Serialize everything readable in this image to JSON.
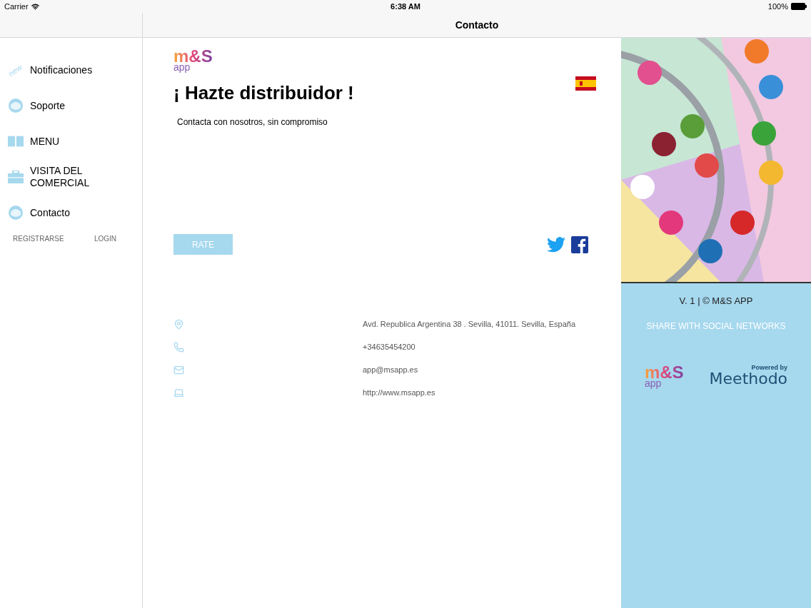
{
  "status_bar": {
    "carrier": "Carrier",
    "time": "6:38 AM",
    "battery": "100%"
  },
  "nav_bar": {
    "title": "Contacto"
  },
  "sidebar": {
    "items": [
      {
        "kind": "new",
        "label": "Notificaciones",
        "badge": "new"
      },
      {
        "kind": "face",
        "label": "Soporte"
      },
      {
        "kind": "book",
        "label": "MENU"
      },
      {
        "kind": "case",
        "label": "VISITA DEL COMERCIAL"
      },
      {
        "kind": "face",
        "label": "Contacto"
      }
    ],
    "links": [
      "REGISTRARSE",
      "LOGIN"
    ]
  },
  "main": {
    "logo": {
      "mark": "m&S",
      "sub": "app"
    },
    "title": "¡ Hazte distribuidor !",
    "subtitle": "Contacta con nosotros, sin compromiso",
    "rate_button": "RATE",
    "contacts": [
      {
        "kind": "pin",
        "value": "Avd. Republica Argentina 38 . Sevilla, 41011. Sevilla, España"
      },
      {
        "kind": "phone",
        "value": "+34635454200"
      },
      {
        "kind": "mail",
        "value": "app@msapp.es"
      },
      {
        "kind": "web",
        "value": "http://www.msapp.es"
      }
    ]
  },
  "side_panel": {
    "version": "V. 1 | © M&S APP",
    "share": "SHARE WITH SOCIAL NETWORKS",
    "logo": {
      "mark": "m&S",
      "sub": "app"
    },
    "powered": {
      "caption": "Powered by",
      "name": "Meethodo"
    }
  }
}
